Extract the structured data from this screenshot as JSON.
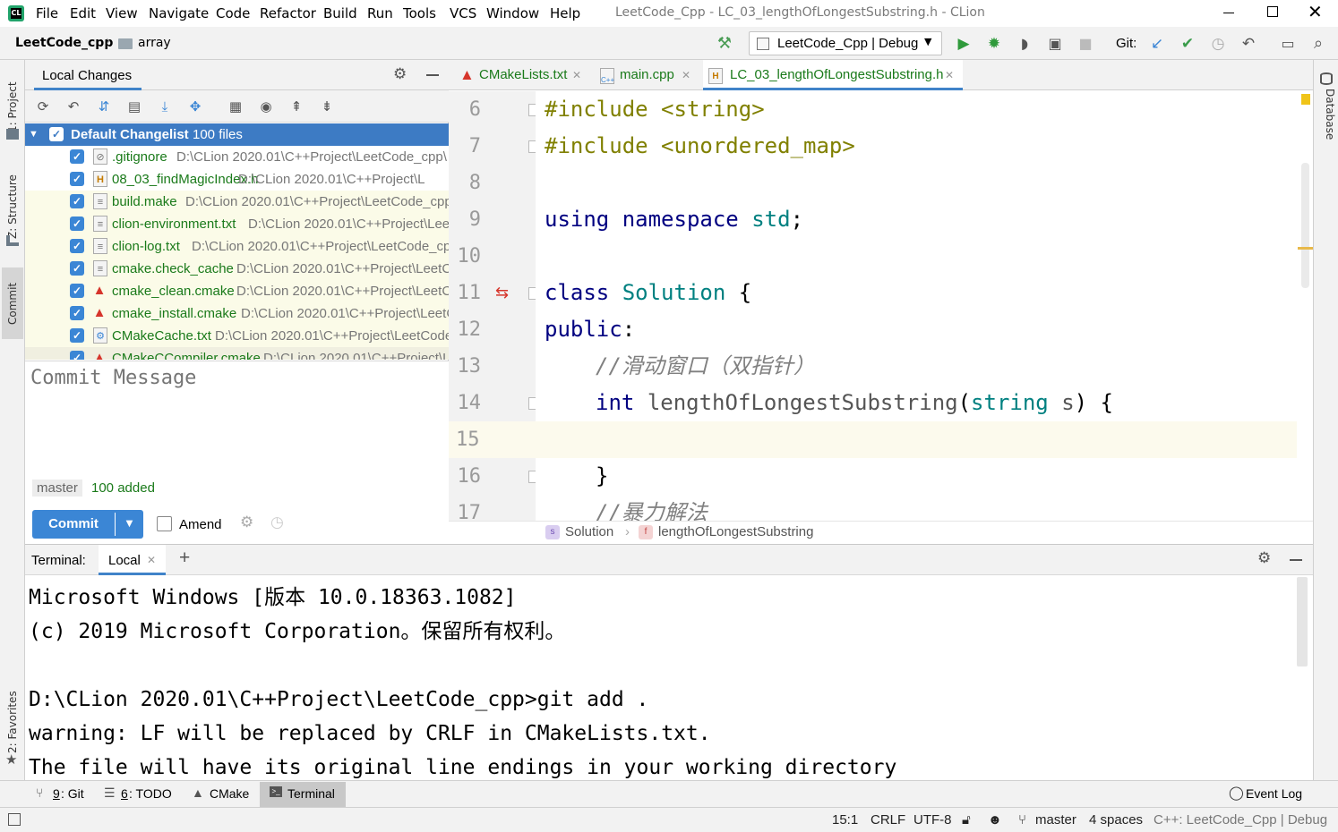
{
  "window": {
    "title": "LeetCode_Cpp - LC_03_lengthOfLongestSubstring.h - CLion",
    "menu": [
      "File",
      "Edit",
      "View",
      "Navigate",
      "Code",
      "Refactor",
      "Build",
      "Run",
      "Tools",
      "VCS",
      "Window",
      "Help"
    ]
  },
  "navbar": {
    "breadcrumb_project": "LeetCode_cpp",
    "breadcrumb_folder": "array",
    "run_config": "LeetCode_Cpp | Debug",
    "git_label": "Git:"
  },
  "side_tabs": {
    "left": [
      "1: Project",
      "Z: Structure",
      "Commit",
      "2: Favorites"
    ],
    "right": [
      "Database"
    ]
  },
  "commit_panel": {
    "tab_title": "Local Changes",
    "changelist_name": "Default Changelist",
    "changelist_count": "100 files",
    "files": [
      {
        "name": ".gitignore",
        "path": "D:\\CLion 2020.01\\C++Project\\LeetCode_cpp\\",
        "icon": "gitignore-icon"
      },
      {
        "name": "08_03_findMagicIndex.h",
        "path": "D:\\CLion 2020.01\\C++Project\\L",
        "icon": "header-file-icon"
      },
      {
        "name": "build.make",
        "path": "D:\\CLion 2020.01\\C++Project\\LeetCode_cpp",
        "icon": "text-file-icon"
      },
      {
        "name": "clion-environment.txt",
        "path": "D:\\CLion 2020.01\\C++Project\\Lee",
        "icon": "text-file-icon"
      },
      {
        "name": "clion-log.txt",
        "path": "D:\\CLion 2020.01\\C++Project\\LeetCode_cp",
        "icon": "text-file-icon"
      },
      {
        "name": "cmake.check_cache",
        "path": "D:\\CLion 2020.01\\C++Project\\LeetC",
        "icon": "text-file-icon"
      },
      {
        "name": "cmake_clean.cmake",
        "path": "D:\\CLion 2020.01\\C++Project\\LeetC",
        "icon": "cmake-icon"
      },
      {
        "name": "cmake_install.cmake",
        "path": "D:\\CLion 2020.01\\C++Project\\LeetC",
        "icon": "cmake-icon"
      },
      {
        "name": "CMakeCache.txt",
        "path": "D:\\CLion 2020.01\\C++Project\\LeetCode",
        "icon": "cmake-cache-icon"
      },
      {
        "name": "CMakeCCompiler.cmake",
        "path": "D:\\CLion 2020.01\\C++Project\\L",
        "icon": "cmake-icon"
      }
    ],
    "commit_message_placeholder": "Commit Message",
    "branch": "master",
    "added_summary": "100 added",
    "commit_button": "Commit",
    "amend_label": "Amend"
  },
  "editor": {
    "tabs": [
      {
        "label": "CMakeLists.txt",
        "icon": "cmake-icon"
      },
      {
        "label": "main.cpp",
        "icon": "cpp-file-icon"
      },
      {
        "label": "LC_03_lengthOfLongestSubstring.h",
        "icon": "header-file-icon",
        "active": true
      }
    ],
    "line_numbers": [
      "6",
      "7",
      "8",
      "9",
      "10",
      "11",
      "12",
      "13",
      "14",
      "15",
      "16",
      "17"
    ],
    "code": {
      "l6_directive": "#include",
      "l6_arg": "<string>",
      "l7_directive": "#include",
      "l7_arg": "<unordered_map>",
      "l9_kw1": "using",
      "l9_kw2": "namespace",
      "l9_ns": "std",
      "l9_semi": ";",
      "l11_kw": "class",
      "l11_name": "Solution",
      "l11_brace": "{",
      "l12_kw": "public",
      "l12_colon": ":",
      "l13_comment": "//滑动窗口（双指针）",
      "l14_type": "int",
      "l14_fn": "lengthOfLongestSubstring",
      "l14_paren": "(",
      "l14_ptype": "string",
      "l14_param": "s",
      "l14_end": ") {",
      "l16_brace": "}",
      "l17_comment": "//暴力解法"
    },
    "breadcrumb_class": "Solution",
    "breadcrumb_method": "lengthOfLongestSubstring",
    "colors": {
      "keyword": "#000080",
      "type_name": "#008080",
      "directive": "#808000",
      "comment": "#808080",
      "current_line": "#fcfaed"
    }
  },
  "terminal": {
    "label": "Terminal:",
    "tab": "Local",
    "lines": [
      "Microsoft Windows [版本 10.0.18363.1082]",
      "(c) 2019 Microsoft Corporation。保留所有权利。",
      "",
      "D:\\CLion 2020.01\\C++Project\\LeetCode_cpp>git add .",
      "warning: LF will be replaced by CRLF in CMakeLists.txt.",
      "The file will have its original line endings in your working directory"
    ]
  },
  "bottom_tabs": [
    {
      "key": "9",
      "label": ": Git",
      "icon": "git-branch-icon"
    },
    {
      "key": "6",
      "label": ": TODO",
      "icon": "todo-list-icon"
    },
    {
      "key": "",
      "label": "CMake",
      "icon": "cmake-icon"
    },
    {
      "key": "",
      "label": "Terminal",
      "icon": "terminal-icon",
      "active": true
    }
  ],
  "event_log": "Event Log",
  "status": {
    "position": "15:1",
    "line_sep": "CRLF",
    "encoding": "UTF-8",
    "branch": "master",
    "indent": "4 spaces",
    "context": "C++: LeetCode_Cpp | Debug"
  }
}
